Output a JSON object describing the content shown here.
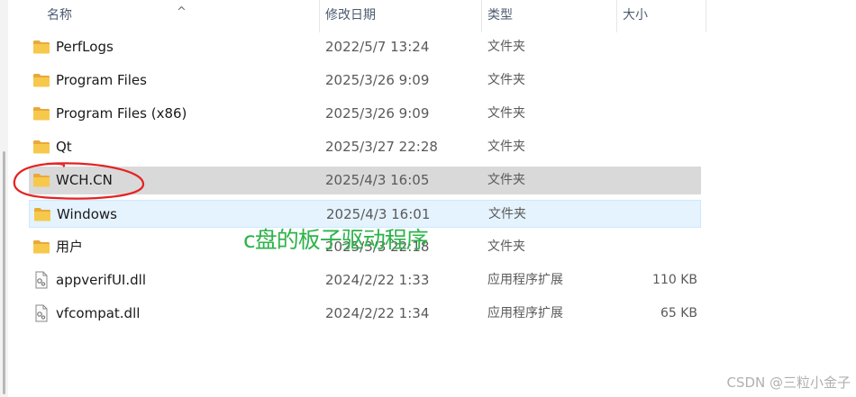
{
  "columns": {
    "name": "名称",
    "modified": "修改日期",
    "type": "类型",
    "size": "大小"
  },
  "sort_indicator": "^",
  "files": [
    {
      "name": "PerfLogs",
      "modified": "2022/5/7 13:24",
      "type": "文件夹",
      "size": "",
      "icon": "folder-icon"
    },
    {
      "name": "Program Files",
      "modified": "2025/3/26 9:09",
      "type": "文件夹",
      "size": "",
      "icon": "folder-icon"
    },
    {
      "name": "Program Files (x86)",
      "modified": "2025/3/26 9:09",
      "type": "文件夹",
      "size": "",
      "icon": "folder-icon"
    },
    {
      "name": "Qt",
      "modified": "2025/3/27 22:28",
      "type": "文件夹",
      "size": "",
      "icon": "folder-icon"
    },
    {
      "name": "WCH.CN",
      "modified": "2025/4/3 16:05",
      "type": "文件夹",
      "size": "",
      "icon": "folder-icon",
      "state": "selected"
    },
    {
      "name": "Windows",
      "modified": "2025/4/3 16:01",
      "type": "文件夹",
      "size": "",
      "icon": "folder-icon",
      "state": "hover"
    },
    {
      "name": "用户",
      "modified": "2025/3/3 22:18",
      "type": "文件夹",
      "size": "",
      "icon": "folder-icon"
    },
    {
      "name": "appverifUI.dll",
      "modified": "2024/2/22 1:33",
      "type": "应用程序扩展",
      "size": "110 KB",
      "icon": "dll-file-icon"
    },
    {
      "name": "vfcompat.dll",
      "modified": "2024/2/22 1:34",
      "type": "应用程序扩展",
      "size": "65 KB",
      "icon": "dll-file-icon"
    }
  ],
  "annotation": {
    "text": "c盘的板子驱动程序",
    "color": "#2db34a",
    "circle_color": "#e52222"
  },
  "watermark": "CSDN @三粒小金子",
  "colors": {
    "selected_row": "#d9d9d9",
    "hover_row": "#e5f3ff",
    "folder": "#f4c542"
  }
}
